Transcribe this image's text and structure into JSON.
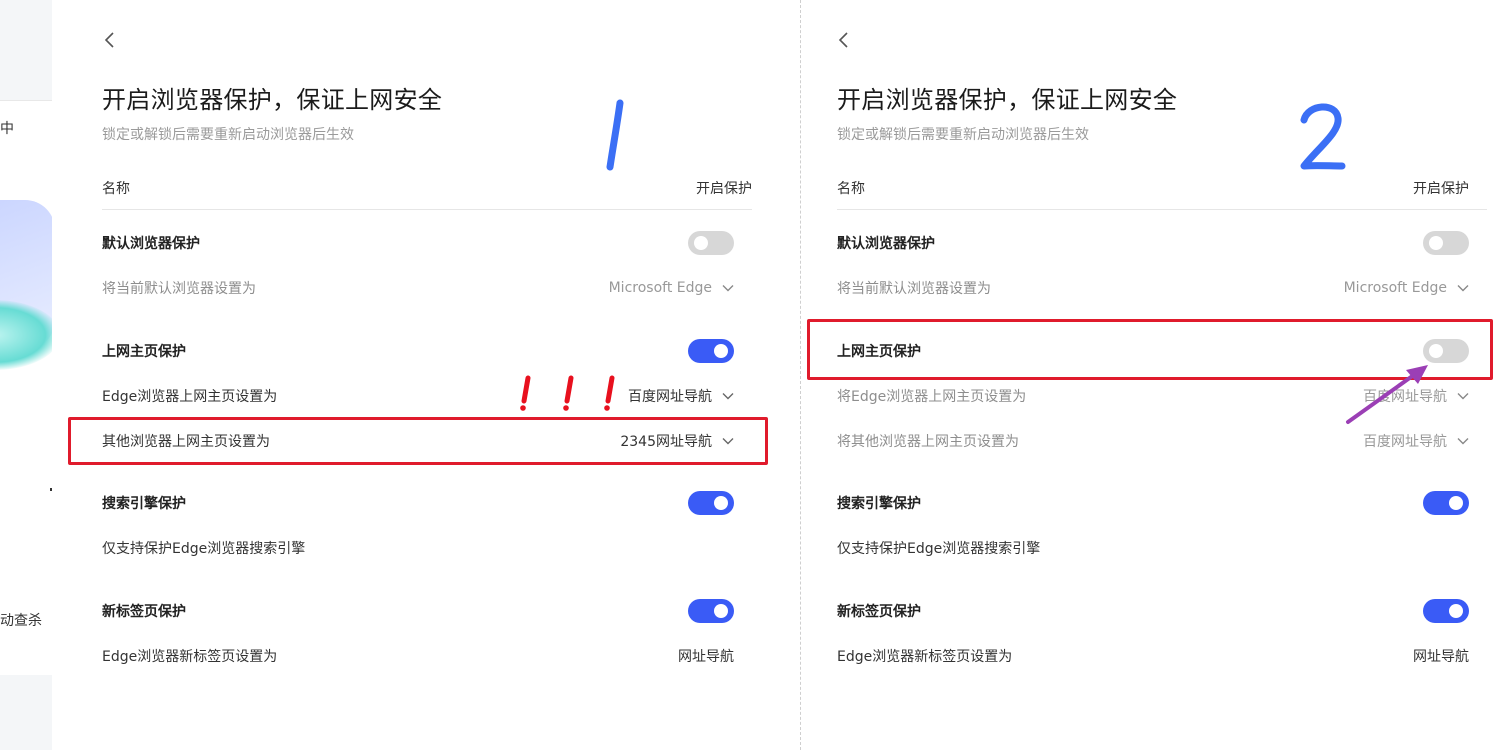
{
  "background_app": {
    "text_top": "中",
    "text_bottom": "动查杀"
  },
  "panels": [
    {
      "title": "开启浏览器保护，保证上网安全",
      "subtitle": "锁定或解锁后需要重新启动浏览器后生效",
      "header": {
        "name": "名称",
        "state": "开启保护"
      },
      "annotation_number": "1",
      "rows": [
        {
          "label": "默认浏览器保护",
          "type": "toggle",
          "on": false
        },
        {
          "label": "将当前默认浏览器设置为",
          "value": "Microsoft Edge",
          "type": "select"
        },
        {
          "label": "上网主页保护",
          "type": "toggle",
          "on": true
        },
        {
          "label": "Edge浏览器上网主页设置为",
          "value": "百度网址导航",
          "type": "select"
        },
        {
          "label": "其他浏览器上网主页设置为",
          "value": "2345网址导航",
          "type": "select"
        },
        {
          "label": "搜索引擎保护",
          "type": "toggle",
          "on": true
        },
        {
          "label": "仅支持保护Edge浏览器搜索引擎",
          "type": "text"
        },
        {
          "label": "新标签页保护",
          "type": "toggle",
          "on": true
        },
        {
          "label": "Edge浏览器新标签页设置为",
          "value": "网址导航",
          "type": "value"
        }
      ]
    },
    {
      "title": "开启浏览器保护，保证上网安全",
      "subtitle": "锁定或解锁后需要重新启动浏览器后生效",
      "header": {
        "name": "名称",
        "state": "开启保护"
      },
      "annotation_number": "2",
      "rows": [
        {
          "label": "默认浏览器保护",
          "type": "toggle",
          "on": false
        },
        {
          "label": "将当前默认浏览器设置为",
          "value": "Microsoft Edge",
          "type": "select"
        },
        {
          "label": "上网主页保护",
          "type": "toggle",
          "on": false
        },
        {
          "label": "将Edge浏览器上网主页设置为",
          "value": "百度网址导航",
          "type": "select"
        },
        {
          "label": "将其他浏览器上网主页设置为",
          "value": "百度网址导航",
          "type": "select"
        },
        {
          "label": "搜索引擎保护",
          "type": "toggle",
          "on": true
        },
        {
          "label": "仅支持保护Edge浏览器搜索引擎",
          "type": "text"
        },
        {
          "label": "新标签页保护",
          "type": "toggle",
          "on": true
        },
        {
          "label": "Edge浏览器新标签页设置为",
          "value": "网址导航",
          "type": "value"
        }
      ]
    }
  ],
  "colors": {
    "toggle_on": "#3a5bf6",
    "toggle_off": "#d7d7d7",
    "highlight_box": "#e01b2c",
    "annotation_blue": "#3b6ff5",
    "annotation_red": "#e8101e",
    "annotation_arrow": "#9b3fb5"
  }
}
